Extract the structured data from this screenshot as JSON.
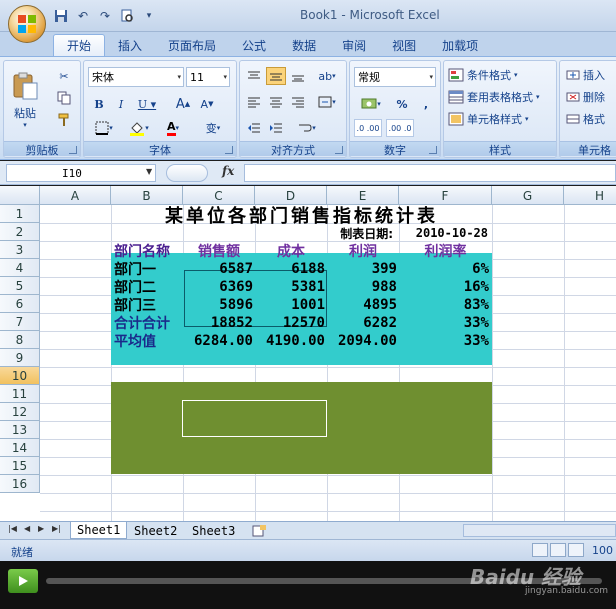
{
  "window": {
    "title": "Book1 - Microsoft Excel"
  },
  "ribbon_tabs": [
    "开始",
    "插入",
    "页面布局",
    "公式",
    "数据",
    "审阅",
    "视图",
    "加载项"
  ],
  "ribbon": {
    "clipboard": {
      "label": "剪贴板",
      "paste": "粘贴"
    },
    "font": {
      "label": "字体",
      "font_name": "宋体",
      "font_size": "11",
      "wen": "变"
    },
    "alignment": {
      "label": "对齐方式"
    },
    "number": {
      "label": "数字",
      "format": "常规"
    },
    "styles": {
      "label": "样式",
      "conditional": "条件格式",
      "table_format": "套用表格格式",
      "cell_styles": "单元格样式"
    },
    "cells": {
      "label": "单元格",
      "insert": "插入",
      "delete": "删除",
      "format": "格式"
    }
  },
  "formula_bar": {
    "name_box": "I10",
    "fx": "fx",
    "formula": ""
  },
  "columns": [
    "A",
    "B",
    "C",
    "D",
    "E",
    "F",
    "G",
    "H"
  ],
  "rows": [
    "1",
    "2",
    "3",
    "4",
    "5",
    "6",
    "7",
    "8",
    "9",
    "10",
    "11",
    "12",
    "13",
    "14",
    "15",
    "16"
  ],
  "sheet": {
    "title": "某单位各部门销售指标统计表",
    "date_label": "制表日期:",
    "date_value": "2010-10-28",
    "headers": [
      "部门名称",
      "销售额",
      "成本",
      "利润",
      "利润率"
    ],
    "data_rows": [
      {
        "name": "部门一",
        "sales": "6587",
        "cost": "6188",
        "profit": "399",
        "rate": "6%"
      },
      {
        "name": "部门二",
        "sales": "6369",
        "cost": "5381",
        "profit": "988",
        "rate": "16%"
      },
      {
        "name": "部门三",
        "sales": "5896",
        "cost": "1001",
        "profit": "4895",
        "rate": "83%"
      },
      {
        "name": "合计合计",
        "sales": "18852",
        "cost": "12570",
        "profit": "6282",
        "rate": "33%"
      },
      {
        "name": "平均值",
        "sales": "6284.00",
        "cost": "4190.00",
        "profit": "2094.00",
        "rate": "33%"
      }
    ]
  },
  "sheet_tabs": [
    "Sheet1",
    "Sheet2",
    "Sheet3"
  ],
  "status": {
    "mode": "就绪",
    "zoom": "100"
  },
  "watermark": {
    "brand": "Baidu 经验",
    "url": "jingyan.baidu.com"
  },
  "colors": {
    "teal_fill": "#33cccc",
    "olive_fill": "#6f8f30",
    "header_purple": "#7030a0"
  }
}
